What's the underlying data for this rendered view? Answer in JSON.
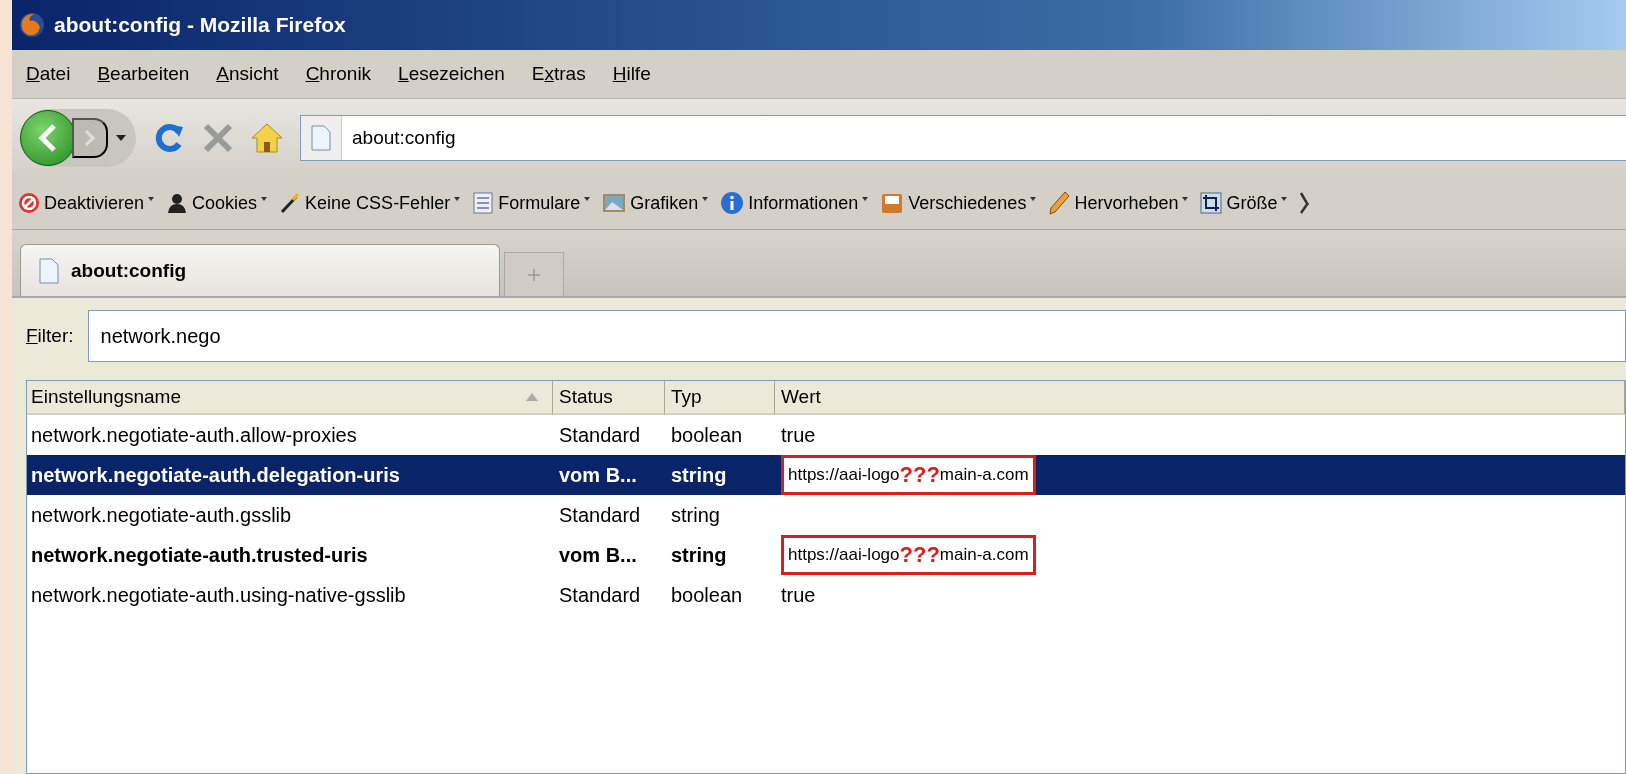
{
  "window": {
    "title": "about:config - Mozilla Firefox"
  },
  "menu": [
    {
      "key": "D",
      "key_after": "atei"
    },
    {
      "key": "B",
      "key_after": "earbeiten"
    },
    {
      "key": "A",
      "key_after": "nsicht"
    },
    {
      "key": "C",
      "key_after": "hronik"
    },
    {
      "key": "L",
      "key_after": "esezeichen"
    },
    {
      "key_before": "E",
      "key": "x",
      "key_after": "tras"
    },
    {
      "key": "H",
      "key_after": "ilfe"
    }
  ],
  "navigation": {
    "address": "about:config"
  },
  "toolbar": [
    {
      "kind": "block",
      "label": "Deaktivieren"
    },
    {
      "kind": "person",
      "label": "Cookies"
    },
    {
      "kind": "wand",
      "label": "Keine CSS-Fehler"
    },
    {
      "kind": "form",
      "label": "Formulare"
    },
    {
      "kind": "picture",
      "label": "Grafiken"
    },
    {
      "kind": "info",
      "label": "Informationen"
    },
    {
      "kind": "tray",
      "label": "Verschiedenes"
    },
    {
      "kind": "pencil",
      "label": "Hervorheben"
    },
    {
      "kind": "crop",
      "label": "Größe"
    },
    {
      "kind": "tool"
    }
  ],
  "tabs": [
    {
      "label": "about:config",
      "selected": true
    }
  ],
  "filter": {
    "key": "F",
    "key_after": "ilter:",
    "value": "network.nego"
  },
  "table": {
    "columns": [
      "Einstellungsname",
      "Status",
      "Typ",
      "Wert"
    ],
    "rows": [
      {
        "name": "network.negotiate-auth.allow-proxies",
        "status": "Standard",
        "type": "boolean",
        "value": "true",
        "modified": false,
        "selected": false
      },
      {
        "name": "network.negotiate-auth.delegation-uris",
        "status": "vom B...",
        "type": "string",
        "value": "https://aai-logo",
        "annotation": "???",
        "value_tail": "main-a.com",
        "modified": true,
        "selected": true
      },
      {
        "name": "network.negotiate-auth.gsslib",
        "status": "Standard",
        "type": "string",
        "modified": false,
        "selected": false
      },
      {
        "name": "network.negotiate-auth.trusted-uris",
        "status": "vom B...",
        "type": "string",
        "value": "https://aai-logo",
        "annotation": "???",
        "value_tail": "main-a.com",
        "modified": true,
        "selected": false
      },
      {
        "name": "network.negotiate-auth.using-native-gsslib",
        "status": "Standard",
        "type": "boolean",
        "value": "true",
        "modified": false,
        "selected": false
      }
    ]
  }
}
